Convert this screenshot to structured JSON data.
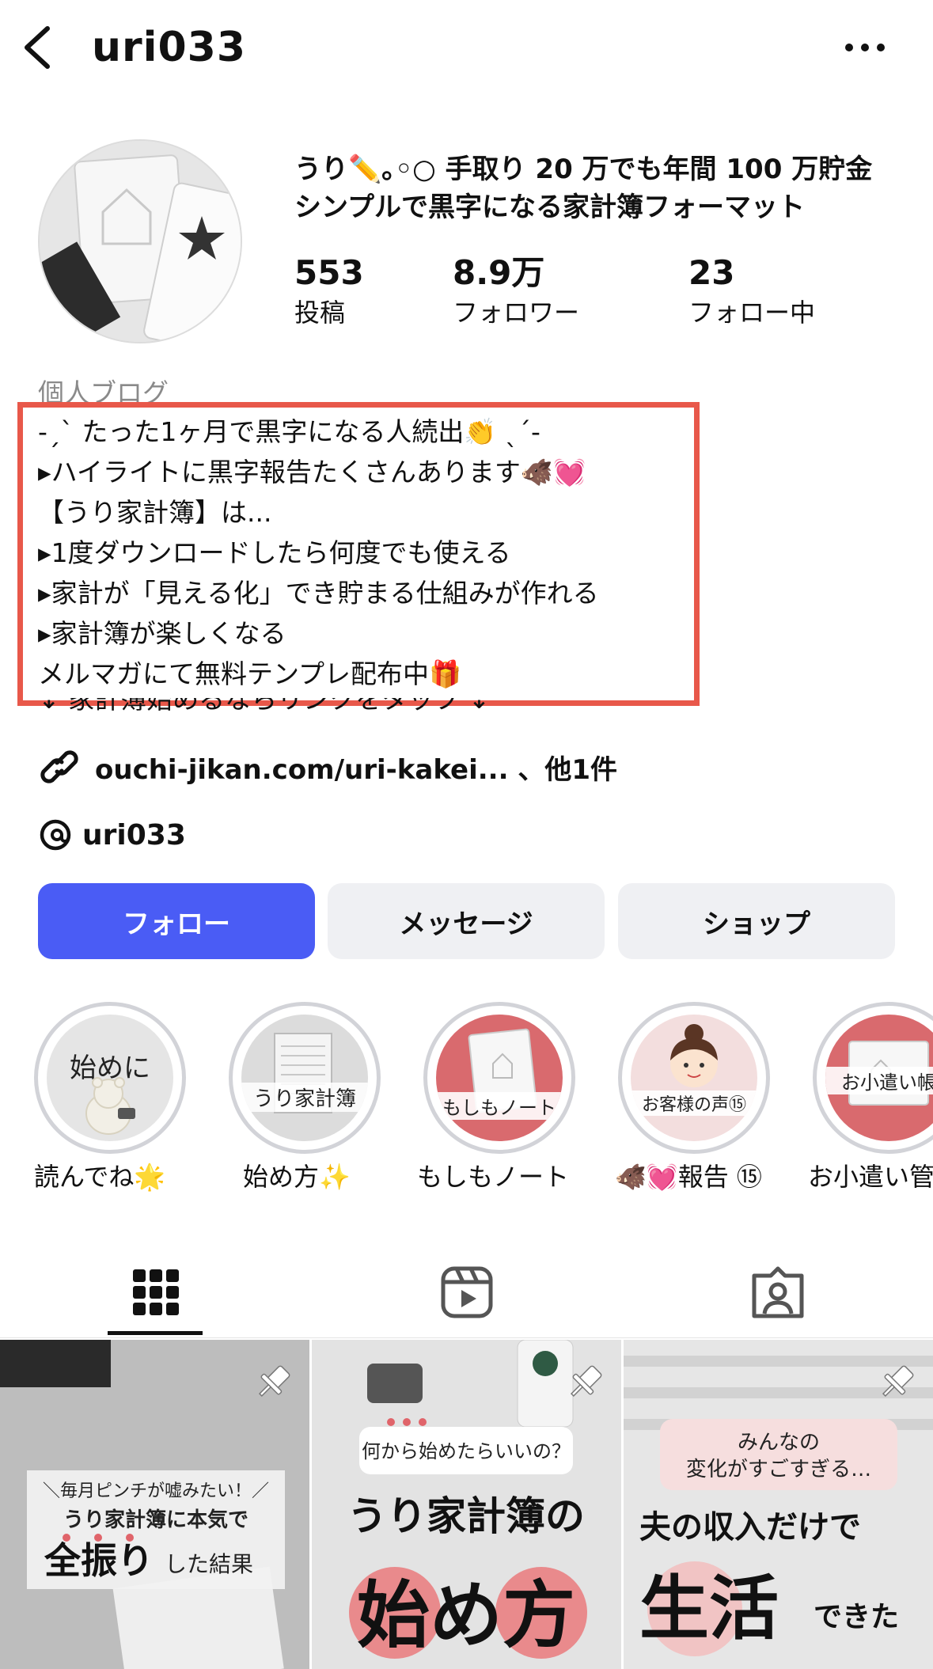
{
  "header": {
    "username": "uri033"
  },
  "profile": {
    "headline_1": "うり✏️｡◦○ 手取り 20 万でも年間 100 万貯金",
    "headline_2": "シンプルで黒字になる家計簿フォーマット",
    "stats": [
      {
        "value": "553",
        "label": "投稿"
      },
      {
        "value": "8.9万",
        "label": "フォロワー"
      },
      {
        "value": "23",
        "label": "フォロー中"
      }
    ],
    "category": "個人ブログ",
    "bio": [
      "-ˏˋ たった1ヶ月で黒字になる人続出👏 ˎˊ-",
      "▸ハイライトに黒字報告たくさんあります🐗💓",
      "【うり家計簿】は...",
      "▸1度ダウンロードしたら何度でも使える",
      "▸家計が「見える化」でき貯まる仕組みが作れる",
      "▸家計簿が楽しくなる",
      "メルマガにて無料テンプレ配布中🎁"
    ],
    "bio_tail": "⇣ 家計簿始めるならリンクをタップ ⇣",
    "link_text": "ouchi-jikan.com/uri-kakei... 、他1件",
    "threads_handle": "uri033"
  },
  "buttons": {
    "follow": "フォロー",
    "message": "メッセージ",
    "shop": "ショップ"
  },
  "highlights": [
    {
      "label": "読んでね🌟",
      "cover_text": "始めに"
    },
    {
      "label": "始め方✨",
      "cover_text": "うり家計簿"
    },
    {
      "label": "もしもノート",
      "cover_text": "もしもノート"
    },
    {
      "label": "🐗💓報告 ⑮",
      "cover_text": "お客様の声⑮"
    },
    {
      "label": "お小遣い管",
      "cover_text": "お小遣い帳"
    }
  ],
  "posts": [
    {
      "top": "＼毎月ピンチが嘘みたい！／",
      "mid": "うり家計簿に本気で",
      "big": "全振り",
      "small": "した結果"
    },
    {
      "top": "何から始めたらいいの？",
      "mid": "うり家計簿の",
      "big": "始め方"
    },
    {
      "top": "みんなの",
      "top2": "変化がすごすぎる…",
      "mid": "夫の収入だけで",
      "big": "生活",
      "small": "できた"
    }
  ],
  "colors": {
    "accent": "#4a5cf5",
    "highlight_box": "#e8584a",
    "button_bg": "#eff0f3",
    "ring": "#d2d3d8"
  }
}
